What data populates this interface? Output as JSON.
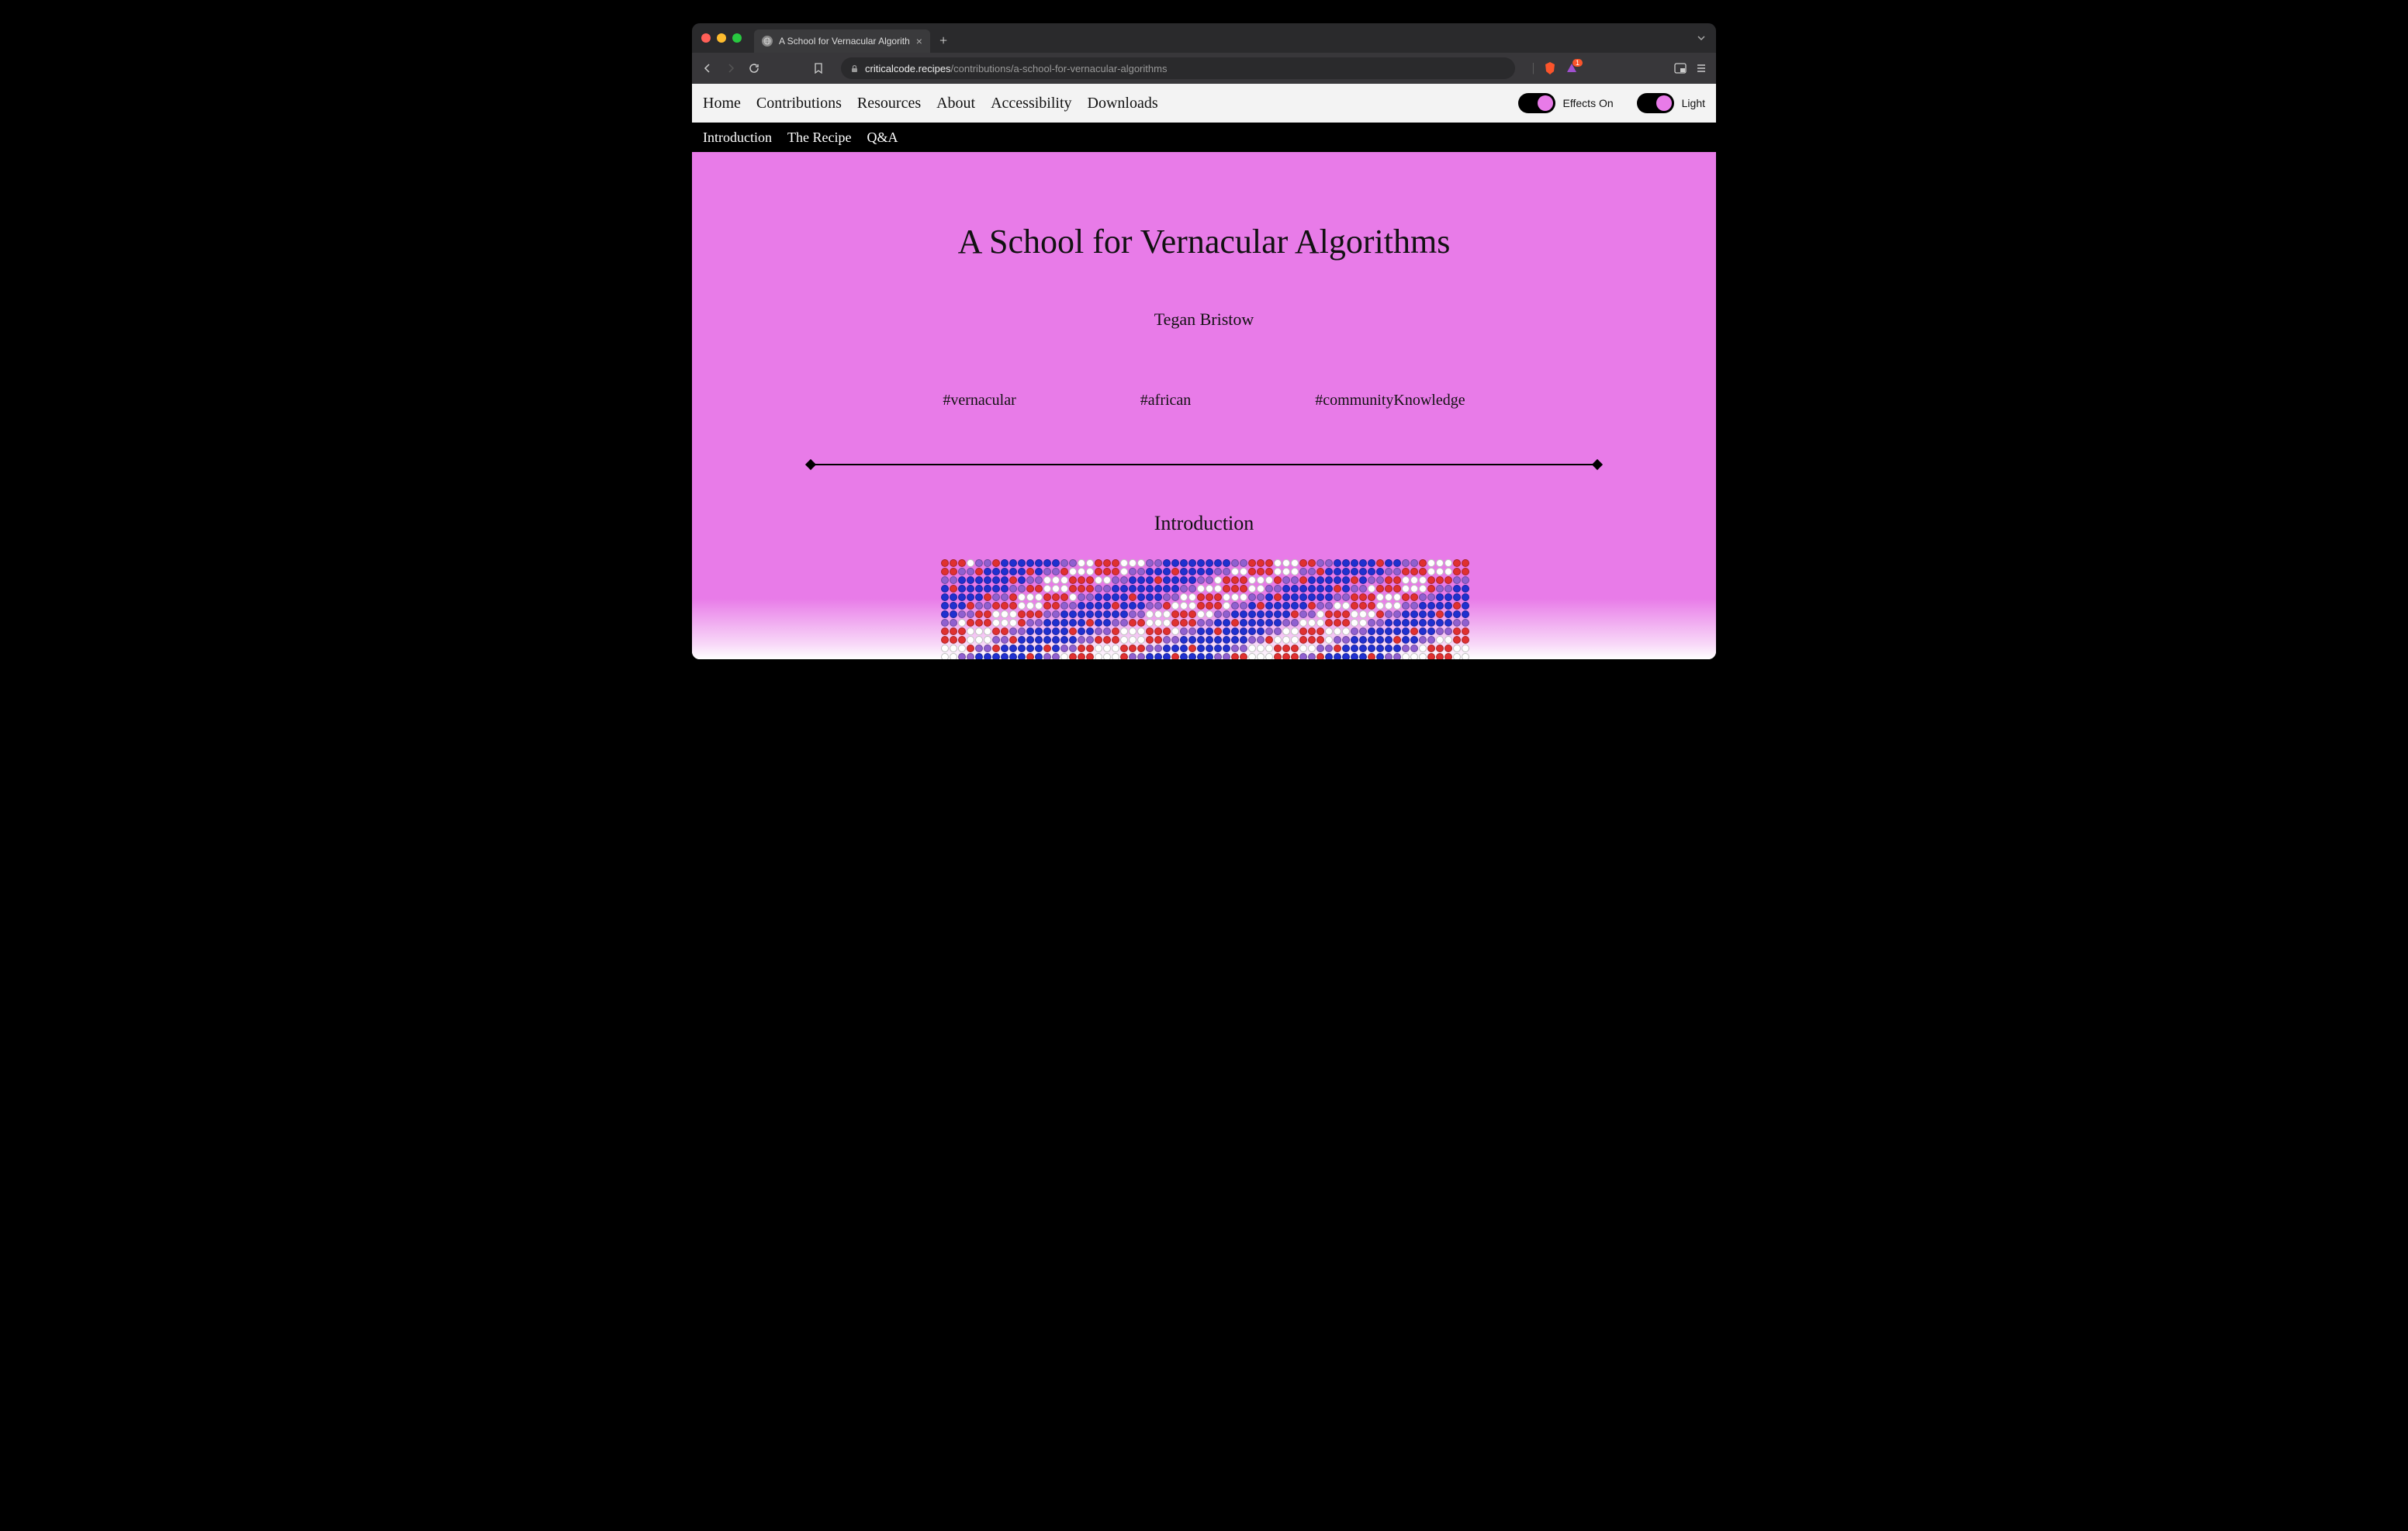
{
  "browser": {
    "tab_title": "A School for Vernacular Algorith",
    "url_domain": "criticalcode.recipes",
    "url_path": "/contributions/a-school-for-vernacular-algorithms",
    "badge_count": "1"
  },
  "site_nav": {
    "items": [
      "Home",
      "Contributions",
      "Resources",
      "About",
      "Accessibility",
      "Downloads"
    ],
    "effects_label": "Effects On",
    "theme_label": "Light"
  },
  "sub_nav": {
    "items": [
      "Introduction",
      "The Recipe",
      "Q&A"
    ]
  },
  "article": {
    "title": "A School for Vernacular Algorithms",
    "author": "Tegan Bristow",
    "tags": [
      "#vernacular",
      "#african",
      "#communityKnowledge"
    ],
    "section_heading": "Introduction"
  },
  "bead_colors": {
    "palette": {
      "w": "#ffffff",
      "r": "#e03030",
      "b": "#2030d0",
      "p": "#9060d0"
    }
  }
}
